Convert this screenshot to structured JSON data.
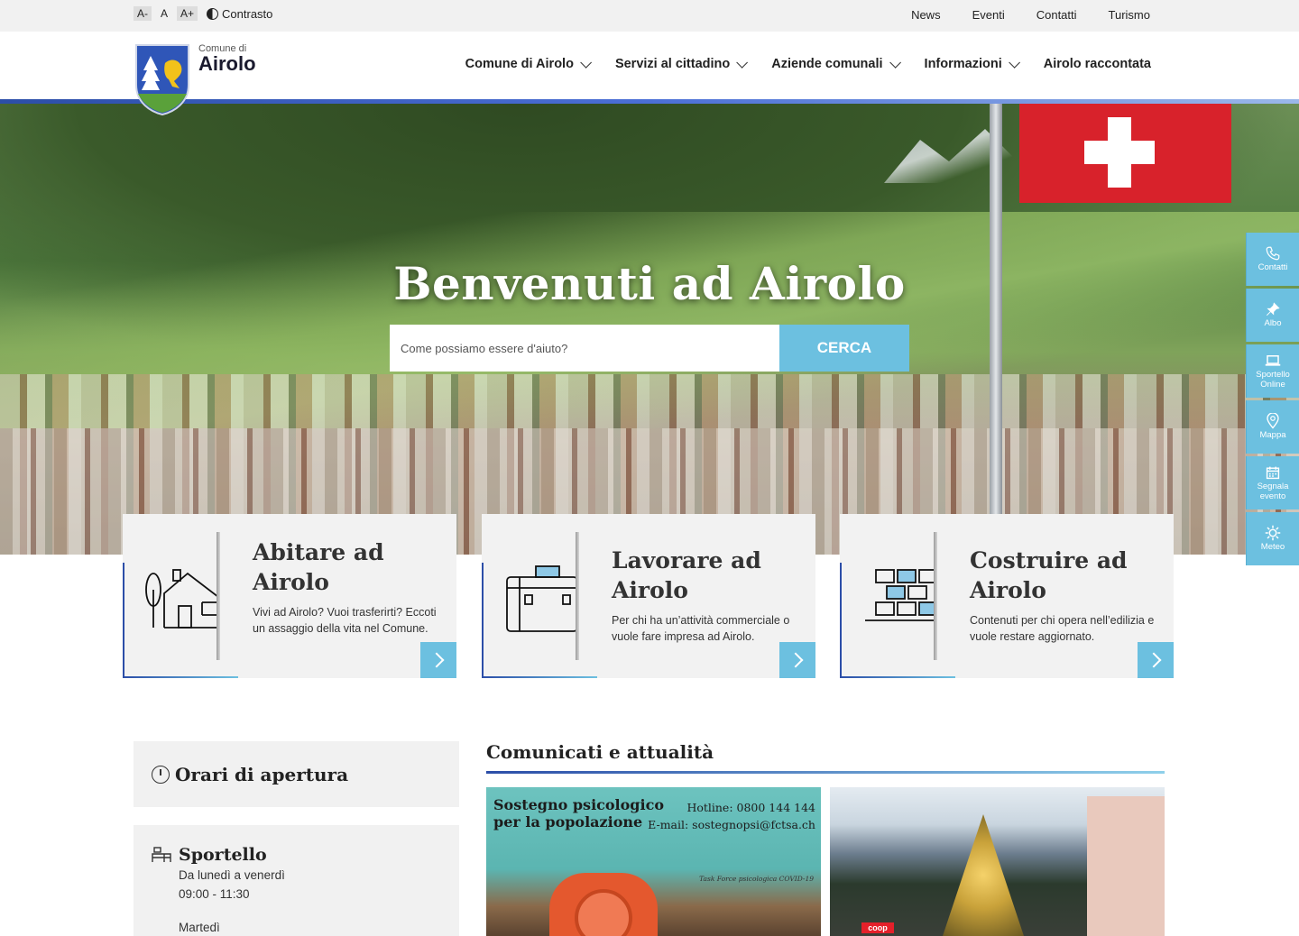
{
  "topbar": {
    "font_small": "A-",
    "font_normal": "A",
    "font_large": "A+",
    "contrast": "Contrasto",
    "links": [
      "News",
      "Eventi",
      "Contatti",
      "Turismo"
    ]
  },
  "header": {
    "brand_small": "Comune di",
    "brand_name": "Airolo",
    "nav": [
      {
        "label": "Comune di Airolo",
        "dropdown": true
      },
      {
        "label": "Servizi al cittadino",
        "dropdown": true
      },
      {
        "label": "Aziende comunali",
        "dropdown": true
      },
      {
        "label": "Informazioni",
        "dropdown": true
      },
      {
        "label": "Airolo raccontata",
        "dropdown": false
      }
    ]
  },
  "hero": {
    "title": "Benvenuti ad Airolo",
    "search_placeholder": "Come possiamo essere d'aiuto?",
    "search_button": "CERCA"
  },
  "quick_links": [
    {
      "label": "Contatti",
      "icon": "phone-icon"
    },
    {
      "label": "Albo",
      "icon": "pin-icon"
    },
    {
      "label": "Sportello Online",
      "icon": "laptop-icon"
    },
    {
      "label": "Mappa",
      "icon": "map-marker-icon"
    },
    {
      "label": "Segnala evento",
      "icon": "calendar-icon"
    },
    {
      "label": "Meteo",
      "icon": "sun-icon"
    }
  ],
  "cards": [
    {
      "title": "Abitare ad Airolo",
      "desc": "Vivi ad Airolo? Vuoi trasferirti? Eccoti un assaggio della vita nel Comune.",
      "icon": "house-icon"
    },
    {
      "title": "Lavorare ad Airolo",
      "desc": "Per chi ha un’attività commerciale o vuole fare impresa ad Airolo.",
      "icon": "briefcase-icon"
    },
    {
      "title": "Costruire ad Airolo",
      "desc": "Contenuti per chi opera nell’edilizia e vuole restare aggiornato.",
      "icon": "bricks-icon"
    }
  ],
  "orari": {
    "title": "Orari di apertura",
    "section": "Sportello",
    "line1": "Da lunedì a venerdì",
    "line2": "09:00 - 11:30",
    "line3": "Martedì"
  },
  "news": {
    "title": "Comunicati e attualità",
    "item1": {
      "heading_l1": "Sostegno psicologico",
      "heading_l2": "per la popolazione",
      "hotline": "Hotline: 0800 144 144",
      "email": "E-mail: sostegnopsi@fctsa.ch",
      "credit": "Task Force psicologica COVID-19"
    },
    "item2": {
      "sign": "coop"
    }
  },
  "colors": {
    "accent": "#6cc0e0",
    "blue": "#2c4ea8",
    "panel": "#f2f2f2"
  }
}
